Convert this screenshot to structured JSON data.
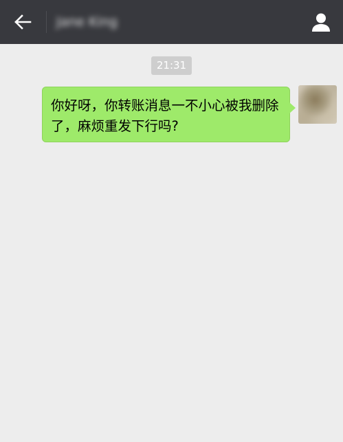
{
  "header": {
    "back_icon": "back-arrow-icon",
    "contact_name": "Jane King",
    "profile_icon": "user-icon",
    "background": "#38393e"
  },
  "chat": {
    "background": "#ededed",
    "timestamp": "21:31",
    "messages": [
      {
        "sender": "self",
        "bubble_color": "#9eea6a",
        "text": "你好呀，你转账消息一不小心被我删除了，麻烦重发下行吗?"
      }
    ]
  }
}
